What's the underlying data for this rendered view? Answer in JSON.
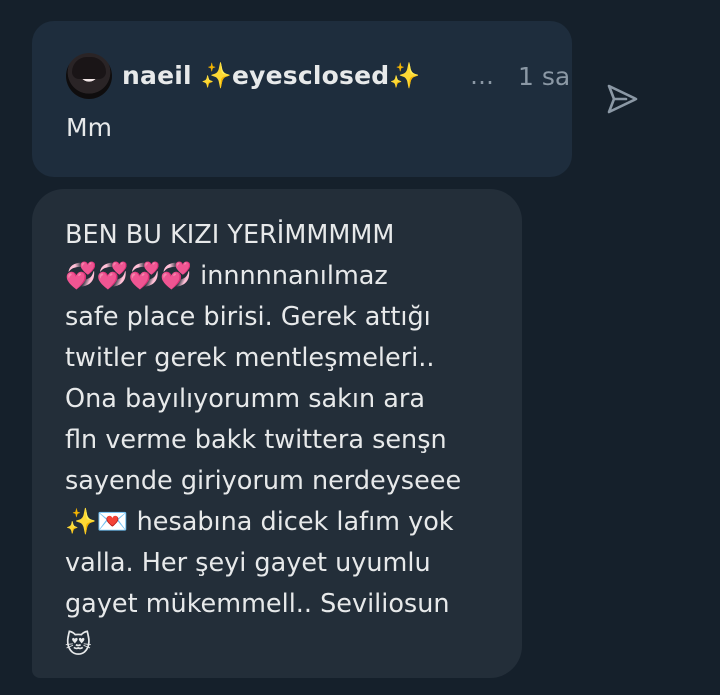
{
  "quoted": {
    "author": "naeil ✨eyesclosed✨",
    "ellipsis": "…",
    "time": "1 sa",
    "text": "Mm"
  },
  "message": {
    "text": "BEN BU KIZI YERİMMMMM\n💞💞💞💞 innnnnanılmaz\nsafe place birisi. Gerek attığı\ntwitler gerek mentleşmeleri..\nOna bayılıyorumm sakın ara\nfln verme bakk twittera senşn\nsayende giriyorum nerdeyseee\n✨💌 hesabına dicek lafım yok\nvalla. Her şeyi gayet uyumlu\ngayet mükemmell.. Seviliosun\n😻"
  },
  "icons": {
    "send": "send-icon",
    "avatar": "avatar"
  },
  "colors": {
    "background": "#15202b",
    "quoted_card": "#1e2d3d",
    "message_bubble": "#232e39",
    "text": "#e7e9ea",
    "muted": "#8b98a5"
  }
}
